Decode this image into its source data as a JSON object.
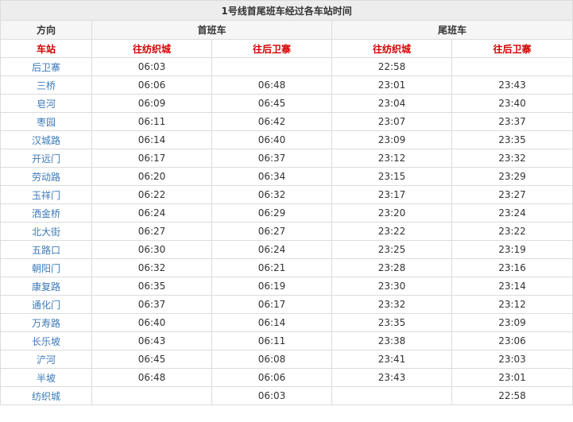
{
  "title": "1号线首尾班车经过各车站时间",
  "header": {
    "direction_label": "方向",
    "first_train_label": "首班车",
    "last_train_label": "尾班车"
  },
  "subheader": {
    "station_label": "车站",
    "first_to_fangzhicheng": "往纺织城",
    "first_to_houweizhai": "往后卫寨",
    "last_to_fangzhicheng": "往纺织城",
    "last_to_houweizhai": "往后卫寨"
  },
  "rows": [
    {
      "station": "后卫寨",
      "first_to_fzc": "06:03",
      "first_to_hwz": "",
      "last_to_fzc": "22:58",
      "last_to_hwz": ""
    },
    {
      "station": "三桥",
      "first_to_fzc": "06:06",
      "first_to_hwz": "06:48",
      "last_to_fzc": "23:01",
      "last_to_hwz": "23:43"
    },
    {
      "station": "皂河",
      "first_to_fzc": "06:09",
      "first_to_hwz": "06:45",
      "last_to_fzc": "23:04",
      "last_to_hwz": "23:40"
    },
    {
      "station": "枣园",
      "first_to_fzc": "06:11",
      "first_to_hwz": "06:42",
      "last_to_fzc": "23:07",
      "last_to_hwz": "23:37"
    },
    {
      "station": "汉城路",
      "first_to_fzc": "06:14",
      "first_to_hwz": "06:40",
      "last_to_fzc": "23:09",
      "last_to_hwz": "23:35"
    },
    {
      "station": "开远门",
      "first_to_fzc": "06:17",
      "first_to_hwz": "06:37",
      "last_to_fzc": "23:12",
      "last_to_hwz": "23:32"
    },
    {
      "station": "劳动路",
      "first_to_fzc": "06:20",
      "first_to_hwz": "06:34",
      "last_to_fzc": "23:15",
      "last_to_hwz": "23:29"
    },
    {
      "station": "玉祥门",
      "first_to_fzc": "06:22",
      "first_to_hwz": "06:32",
      "last_to_fzc": "23:17",
      "last_to_hwz": "23:27"
    },
    {
      "station": "洒金桥",
      "first_to_fzc": "06:24",
      "first_to_hwz": "06:29",
      "last_to_fzc": "23:20",
      "last_to_hwz": "23:24"
    },
    {
      "station": "北大街",
      "first_to_fzc": "06:27",
      "first_to_hwz": "06:27",
      "last_to_fzc": "23:22",
      "last_to_hwz": "23:22"
    },
    {
      "station": "五路口",
      "first_to_fzc": "06:30",
      "first_to_hwz": "06:24",
      "last_to_fzc": "23:25",
      "last_to_hwz": "23:19"
    },
    {
      "station": "朝阳门",
      "first_to_fzc": "06:32",
      "first_to_hwz": "06:21",
      "last_to_fzc": "23:28",
      "last_to_hwz": "23:16"
    },
    {
      "station": "康复路",
      "first_to_fzc": "06:35",
      "first_to_hwz": "06:19",
      "last_to_fzc": "23:30",
      "last_to_hwz": "23:14"
    },
    {
      "station": "通化门",
      "first_to_fzc": "06:37",
      "first_to_hwz": "06:17",
      "last_to_fzc": "23:32",
      "last_to_hwz": "23:12"
    },
    {
      "station": "万寿路",
      "first_to_fzc": "06:40",
      "first_to_hwz": "06:14",
      "last_to_fzc": "23:35",
      "last_to_hwz": "23:09"
    },
    {
      "station": "长乐坡",
      "first_to_fzc": "06:43",
      "first_to_hwz": "06:11",
      "last_to_fzc": "23:38",
      "last_to_hwz": "23:06"
    },
    {
      "station": "浐河",
      "first_to_fzc": "06:45",
      "first_to_hwz": "06:08",
      "last_to_fzc": "23:41",
      "last_to_hwz": "23:03"
    },
    {
      "station": "半坡",
      "first_to_fzc": "06:48",
      "first_to_hwz": "06:06",
      "last_to_fzc": "23:43",
      "last_to_hwz": "23:01"
    },
    {
      "station": "纺织城",
      "first_to_fzc": "",
      "first_to_hwz": "06:03",
      "last_to_fzc": "",
      "last_to_hwz": "22:58"
    }
  ]
}
